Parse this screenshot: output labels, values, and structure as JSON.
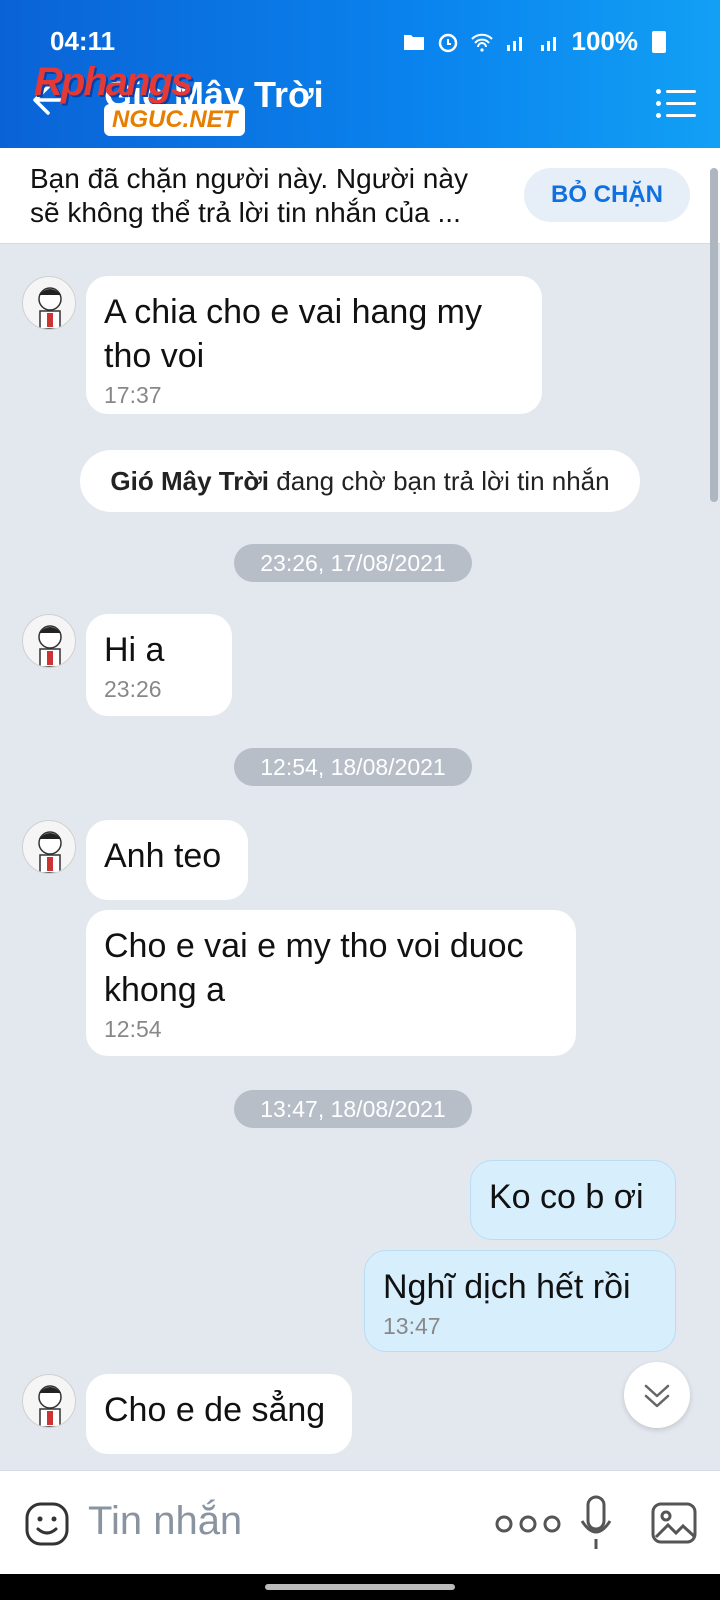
{
  "status_bar": {
    "time": "04:11",
    "battery": "100%"
  },
  "header": {
    "title": "Gió Mây Trời",
    "watermark_top": "Rphangs",
    "watermark_bottom": "NGUC.NET"
  },
  "blocked_notice": {
    "text": "Bạn đã chặn người này. Người này sẽ không thể trả lời tin nhắn của ...",
    "button": "BỎ CHẶN"
  },
  "messages": {
    "m1": {
      "text": " A chia cho e vai hang my tho voi",
      "time": "17:37"
    },
    "waiting_name": "Gió Mây Trời",
    "waiting_rest": " đang chờ bạn trả lời tin nhắn",
    "sep1": "23:26, 17/08/2021",
    "m2": {
      "text": "Hi a",
      "time": "23:26"
    },
    "sep2": "12:54, 18/08/2021",
    "m3": {
      "text": "Anh teo"
    },
    "m4": {
      "text": "Cho e vai e my tho voi duoc khong a",
      "time": "12:54"
    },
    "sep3": "13:47, 18/08/2021",
    "m5": {
      "text": "Ko co b ơi"
    },
    "m6": {
      "text": "Nghĩ dịch hết rồi",
      "time": "13:47"
    },
    "m7": {
      "text": "Cho e de sẳng"
    }
  },
  "composer": {
    "placeholder": "Tin nhắn"
  },
  "colors": {
    "header_blue": "#0a7ae8",
    "chat_bg": "#e3e8ef",
    "my_bubble": "#d7eefd",
    "accent": "#1070e0"
  }
}
